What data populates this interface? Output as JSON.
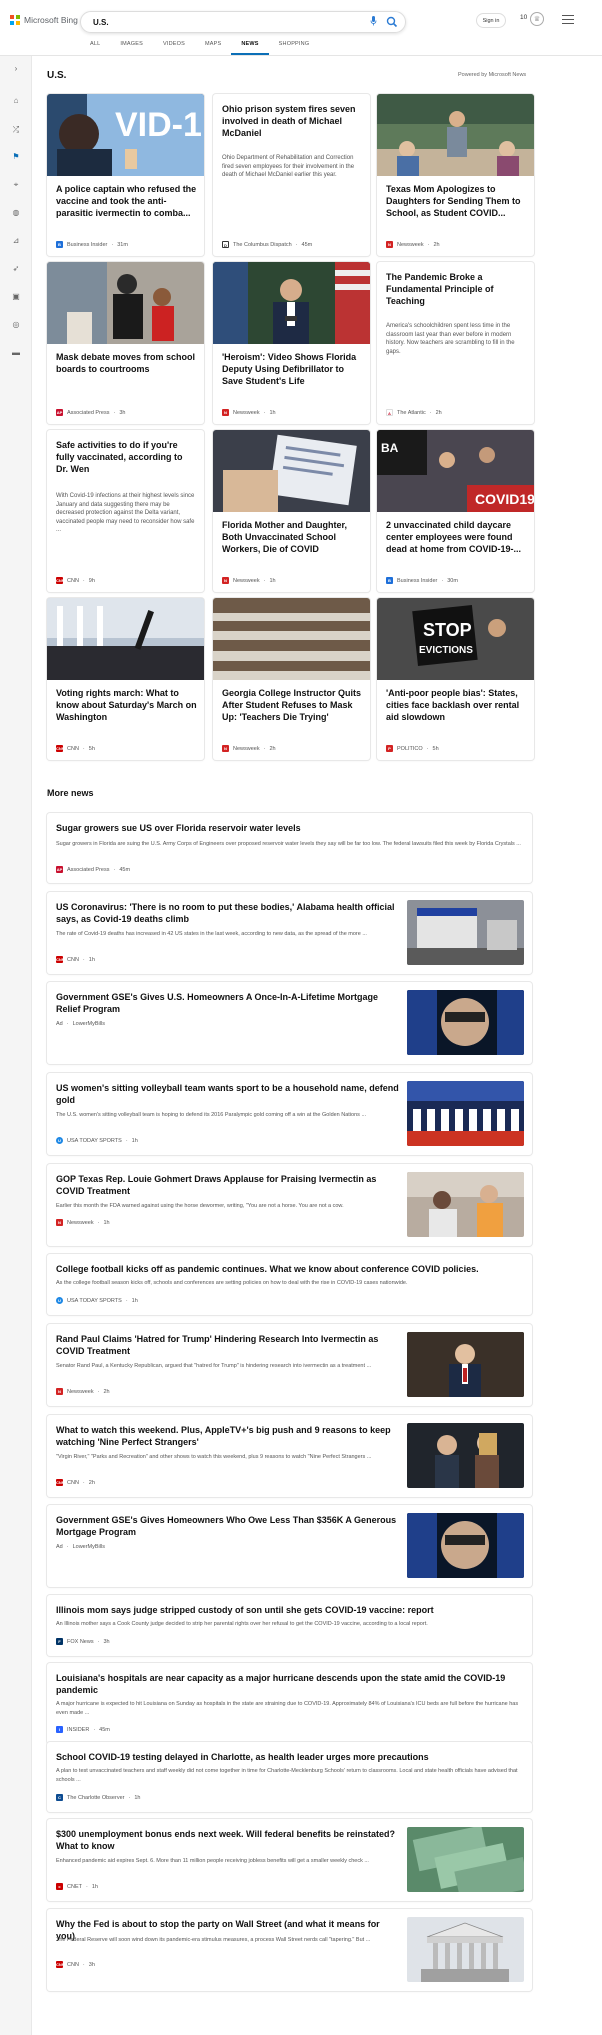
{
  "header": {
    "logo_text": "Microsoft Bing",
    "search_value": "U.S.",
    "signin_label": "Sign in",
    "rewards_count": "10",
    "tabs": [
      {
        "label": "ALL"
      },
      {
        "label": "IMAGES"
      },
      {
        "label": "VIDEOS"
      },
      {
        "label": "MAPS"
      },
      {
        "label": "NEWS"
      },
      {
        "label": "SHOPPING"
      }
    ],
    "active_tab": "NEWS"
  },
  "section": {
    "title": "U.S.",
    "powered_by": "Powered by Microsoft News"
  },
  "cards": [
    {
      "title": "A police captain who refused the vaccine and took the anti-parasitic ivermectin to comba...",
      "source": "Business Insider",
      "time": "31m",
      "color": "#1e6fd9",
      "letter": "B"
    },
    {
      "title": "Ohio prison system fires seven involved in death of Michael McDaniel",
      "snippet": "Ohio Department of Rehabilitation and Correction fired seven employees for their involvement in the death of Michael McDaniel earlier this year.",
      "source": "The Columbus Dispatch",
      "time": "45m",
      "color": "#333",
      "letter": "D"
    },
    {
      "title": "Texas Mom Apologizes to Daughters for Sending Them to School, as Student COVID...",
      "source": "Newsweek",
      "time": "2h",
      "color": "#d32323",
      "letter": "N"
    },
    {
      "title": "Mask debate moves from school boards to courtrooms",
      "source": "Associated Press",
      "time": "3h",
      "color": "#c8102e",
      "letter": "AP"
    },
    {
      "title": "'Heroism': Video Shows Florida Deputy Using Defibrillator to Save Student's Life",
      "source": "Newsweek",
      "time": "1h",
      "color": "#d32323",
      "letter": "N"
    },
    {
      "title": "The Pandemic Broke a Fundamental Principle of Teaching",
      "snippet": "America's schoolchildren spent less time in the classroom last year than ever before in modern history. Now teachers are scrambling to fill in the gaps.",
      "source": "The Atlantic",
      "time": "2h",
      "color": "#c8102e",
      "letter": "A"
    },
    {
      "title": "Safe activities to do if you're fully vaccinated, according to Dr. Wen",
      "snippet": "With Covid-19 infections at their highest levels since January and data suggesting there may be decreased protection against the Delta variant, vaccinated people may need to reconsider how safe ...",
      "source": "CNN",
      "time": "9h",
      "color": "#cc0000",
      "letter": "CNN"
    },
    {
      "title": "Florida Mother and Daughter, Both Unvaccinated School Workers, Die of COVID",
      "source": "Newsweek",
      "time": "1h",
      "color": "#d32323",
      "letter": "N"
    },
    {
      "title": "2 unvaccinated child daycare center employees were found dead at home from COVID-19-...",
      "source": "Business Insider",
      "time": "30m",
      "color": "#1e6fd9",
      "letter": "B"
    },
    {
      "title": "Voting rights march: What to know about Saturday's March on Washington",
      "source": "CNN",
      "time": "5h",
      "color": "#cc0000",
      "letter": "CNN"
    },
    {
      "title": "Georgia College Instructor Quits After Student Refuses to Mask Up: 'Teachers Die Trying'",
      "source": "Newsweek",
      "time": "2h",
      "color": "#d32323",
      "letter": "N"
    },
    {
      "title": "'Anti-poor people bias': States, cities face backlash over rental aid slowdown",
      "source": "POLITICO",
      "time": "5h",
      "color": "#d32323",
      "letter": "P"
    }
  ],
  "more_news": {
    "title": "More news",
    "items": [
      {
        "title": "Sugar growers sue US over Florida reservoir water levels",
        "snippet": "Sugar growers in Florida are suing the U.S. Army Corps of Engineers over proposed reservoir water levels they say will be far too low. The federal lawsuits filed this week by Florida Crystals ...",
        "source": "Associated Press",
        "time": "45m",
        "color": "#c8102e",
        "letter": "AP"
      },
      {
        "title": "US Coronavirus: 'There is no room to put these bodies,' Alabama health official says, as Covid-19 deaths climb",
        "snippet": "The rate of Covid-19 deaths has increased in 42 US states in the last week, according to new data, as the spread of the more ...",
        "source": "CNN",
        "time": "1h",
        "color": "#cc0000",
        "letter": "CNN"
      },
      {
        "title": "Government GSE's Gives U.S. Homeowners A Once-In-A-Lifetime Mortgage Relief Program",
        "ad_label": "Ad",
        "source": "LowerMyBills",
        "time": "",
        "color": "",
        "letter": ""
      },
      {
        "title": "US women's sitting volleyball team wants sport to be a household name, defend gold",
        "snippet": "The U.S. women's sitting volleyball team is hoping to defend its 2016 Paralympic gold coming off a win at the Golden Nations ...",
        "source": "USA TODAY SPORTS",
        "time": "1h",
        "color": "#1e88e5",
        "letter": "U"
      },
      {
        "title": "GOP Texas Rep. Louie Gohmert Draws Applause for Praising Ivermectin as COVID Treatment",
        "snippet": "Earlier this month the FDA warned against using the horse dewormer, writing, \"You are not a horse. You are not a cow.",
        "source": "Newsweek",
        "time": "1h",
        "color": "#d32323",
        "letter": "N"
      },
      {
        "title": "College football kicks off as pandemic continues. What we know about conference COVID policies.",
        "snippet": "As the college football season kicks off, schools and conferences are setting policies on how to deal with the rise in COVID-19 cases nationwide.",
        "source": "USA TODAY SPORTS",
        "time": "1h",
        "color": "#1e88e5",
        "letter": "U"
      },
      {
        "title": "Rand Paul Claims 'Hatred for Trump' Hindering Research Into Ivermectin as COVID Treatment",
        "snippet": "Senator Rand Paul, a Kentucky Republican, argued that \"hatred for Trump\" is hindering research into ivermectin as a treatment ...",
        "source": "Newsweek",
        "time": "2h",
        "color": "#d32323",
        "letter": "N"
      },
      {
        "title": "What to watch this weekend. Plus, AppleTV+'s big push and 9 reasons to keep watching 'Nine Perfect Strangers'",
        "snippet": "\"Virgin River,\" \"Parks and Recreation\" and other shows to watch this weekend, plus 9 reasons to watch \"Nine Perfect Strangers ...",
        "source": "CNN",
        "time": "2h",
        "color": "#cc0000",
        "letter": "CNN"
      },
      {
        "title": "Government GSE's Gives Homeowners Who Owe Less Than $356K A Generous Mortgage Program",
        "ad_label": "Ad",
        "source": "LowerMyBills",
        "time": "",
        "color": "",
        "letter": ""
      },
      {
        "title": "Illinois mom says judge stripped custody of son until she gets COVID-19 vaccine: report",
        "snippet": "An Illinois mother says a Cook County judge decided to strip her parental rights over her refusal to get the COVID-19 vaccine, according to a local report.",
        "source": "FOX News",
        "time": "3h",
        "color": "#003366",
        "letter": "F"
      },
      {
        "title": "Louisiana's hospitals are near capacity as a major hurricane descends upon the state amid the COVID-19 pandemic",
        "snippet": "A major hurricane is expected to hit Louisiana on Sunday as hospitals in the state are straining due to COVID-19. Approximately 84% of Louisiana's ICU beds are full before the hurricane has even made ...",
        "source": "INSIDER",
        "time": "45m",
        "color": "#2962ff",
        "letter": "I"
      },
      {
        "title": "School COVID-19 testing delayed in Charlotte, as health leader urges more precautions",
        "snippet": "A plan to test unvaccinated teachers and staff weekly did not come together in time for Charlotte-Mecklenburg Schools' return to classrooms. Local and state health officials have advised that schools ...",
        "source": "The Charlotte Observer",
        "time": "1h",
        "color": "#0d4c92",
        "letter": "C"
      },
      {
        "title": "$300 unemployment bonus ends next week. Will federal benefits be reinstated? What to know",
        "snippet": "Enhanced pandemic aid expires Sept. 6. More than 11 million people receiving jobless benefits will get a smaller weekly check ...",
        "source": "CNET",
        "time": "1h",
        "color": "#cc0000",
        "letter": "c"
      },
      {
        "title": "Why the Fed is about to stop the party on Wall Street (and what it means for you)",
        "snippet": "The Federal Reserve will soon wind down its pandemic-era stimulus measures, a process Wall Street nerds call \"tapering.\" But ...",
        "source": "CNN",
        "time": "3h",
        "color": "#cc0000",
        "letter": "CNN"
      }
    ]
  }
}
